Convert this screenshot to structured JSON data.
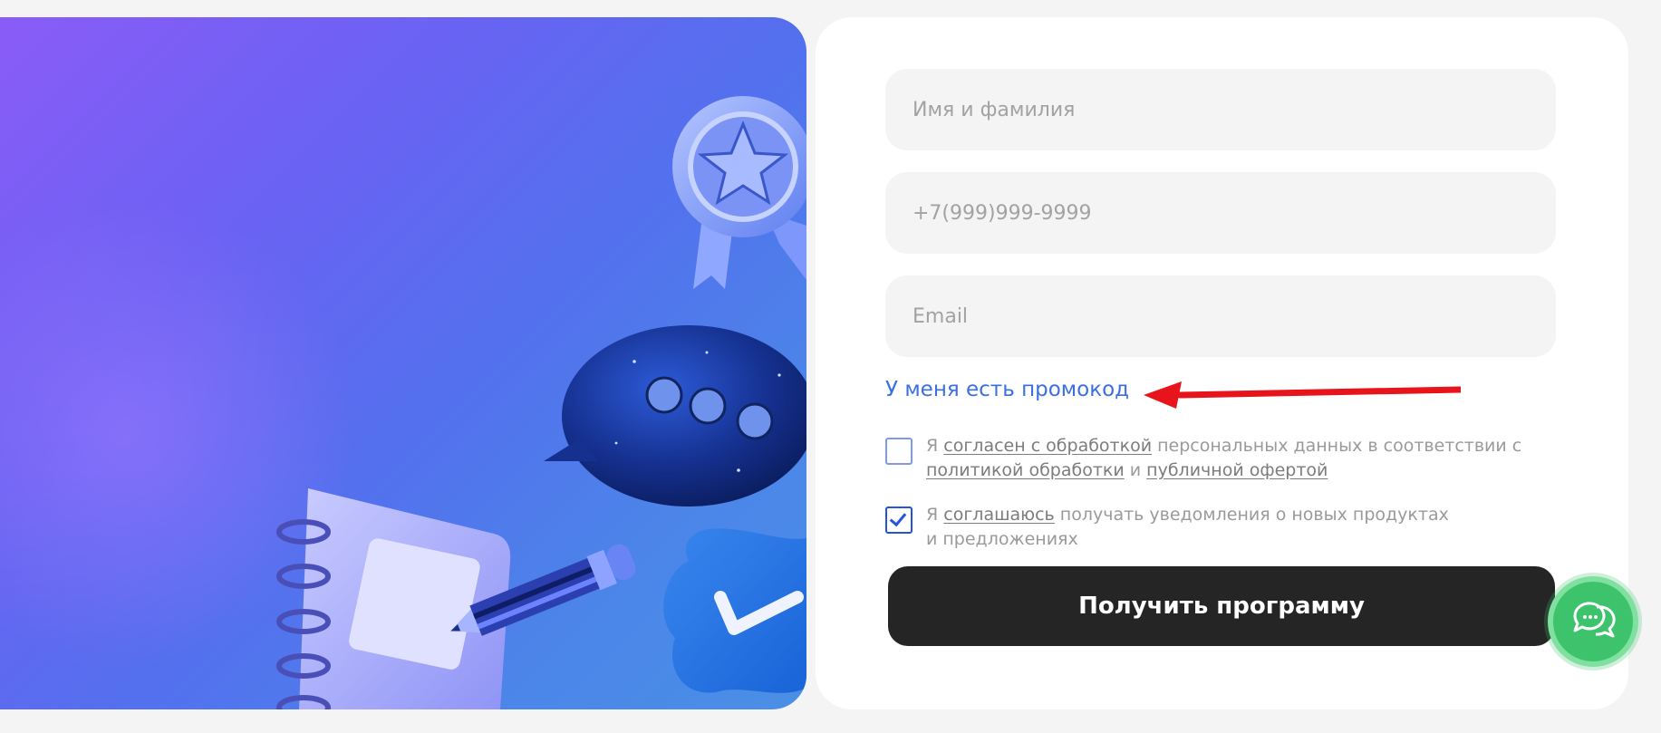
{
  "form": {
    "name_placeholder": "Имя и фамилия",
    "phone_placeholder": "+7(999)999-9999",
    "email_placeholder": "Email",
    "promo_link": "У меня есть промокод",
    "consent_personal": {
      "checked": false,
      "prefix": "Я ",
      "link1": "согласен с обработкой",
      "mid": " персональных данных в соответствии с ",
      "link2": "политикой обработки",
      "and": " и ",
      "link3": "публичной офертой"
    },
    "consent_notify": {
      "checked": true,
      "prefix": "Я ",
      "link1": "соглашаюсь",
      "rest": " получать уведомления о новых продуктах и предложениях"
    },
    "submit_label": "Получить программу"
  },
  "colors": {
    "accent_link": "#3b6fe0",
    "button": "#252525",
    "chat": "#3dc36c",
    "annotation_arrow": "#e8141b"
  },
  "icons": [
    "medal-icon",
    "chat-bubble-icon",
    "notebook-icon",
    "pencil-icon",
    "checkmark-badge-icon",
    "chat-support-icon"
  ]
}
